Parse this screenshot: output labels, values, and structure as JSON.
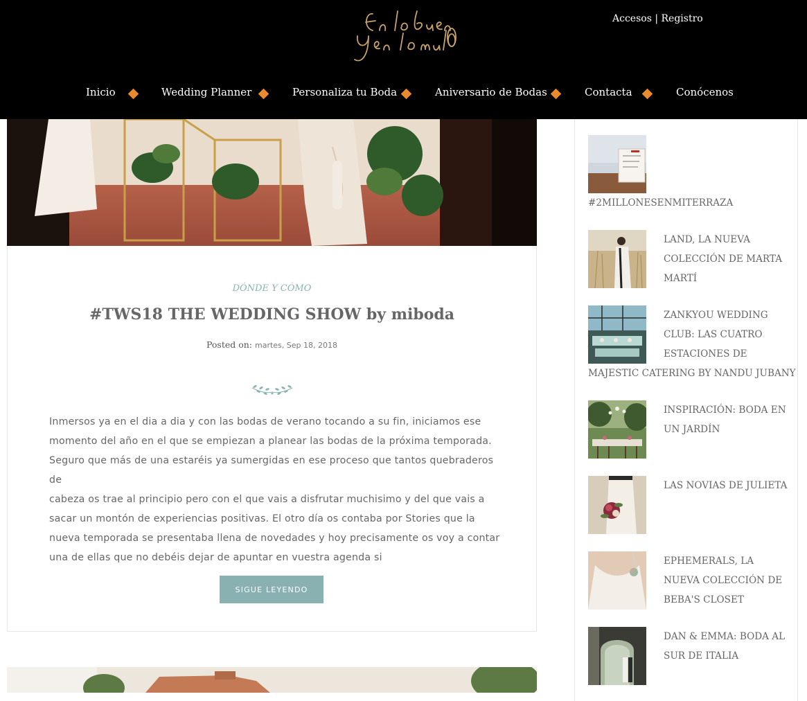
{
  "header": {
    "logo_text": "En lo bueno y en lo malo",
    "account": {
      "login": "Accesos",
      "separator": "|",
      "register": "Registro"
    },
    "nav": [
      {
        "label": "Inicio"
      },
      {
        "label": "Wedding Planner"
      },
      {
        "label": "Personaliza tu Boda"
      },
      {
        "label": "Aniversario de Bodas"
      },
      {
        "label": "Contacta"
      },
      {
        "label": "Conócenos"
      }
    ],
    "accent_color": "#e98a2c"
  },
  "post": {
    "category": "DÓNDE Y CÓMO",
    "title": "#TWS18 THE WEDDING SHOW by miboda",
    "posted_label": "Posted on:",
    "date": "martes, Sep 18, 2018",
    "excerpt_lines": [
      "Inmersos ya en el dia a dia y con las bodas de verano tocando a su fin, iniciamos ese",
      "momento del año en el que se empiezan a planear las bodas de la próxima temporada.",
      "Seguro que más de una estaréis ya sumergidas en ese proceso que tantos quebraderos de",
      "cabeza os trae al principio pero con el que vais a disfrutar muchisimo y del que vais a",
      "sacar un montón de experiencias positivas. El otro día os contaba por Stories que la",
      "nueva temporada se presentaba llena de novedades y hoy precisamente os voy a contar",
      "una de ellas que no debéis dejar de apuntar en vuestra agenda si"
    ],
    "read_more": "SIGUE LEYENDO",
    "button_color": "#8ab1b1"
  },
  "sidebar": {
    "posts": [
      {
        "title": "#2MILLONESENMITERRAZA"
      },
      {
        "title": "LAND, LA NUEVA COLECCIÓN DE MARTA MARTÍ"
      },
      {
        "title_line1": "ZANKYOU WEDDING",
        "title_line2": "CLUB: LAS CUATRO",
        "title_line3": "ESTACIONES DE",
        "title_line4": "MAJESTIC CATERING BY NANDU JUBANY"
      },
      {
        "title": "INSPIRACIÓN: BODA EN UN JARDÍN"
      },
      {
        "title": "LAS NOVIAS DE JULIETA"
      },
      {
        "title": "EPHEMERALS, LA NUEVA COLECCIÓN DE BEBA'S CLOSET"
      },
      {
        "title": "DAN & EMMA: BODA AL SUR DE ITALIA"
      }
    ]
  }
}
